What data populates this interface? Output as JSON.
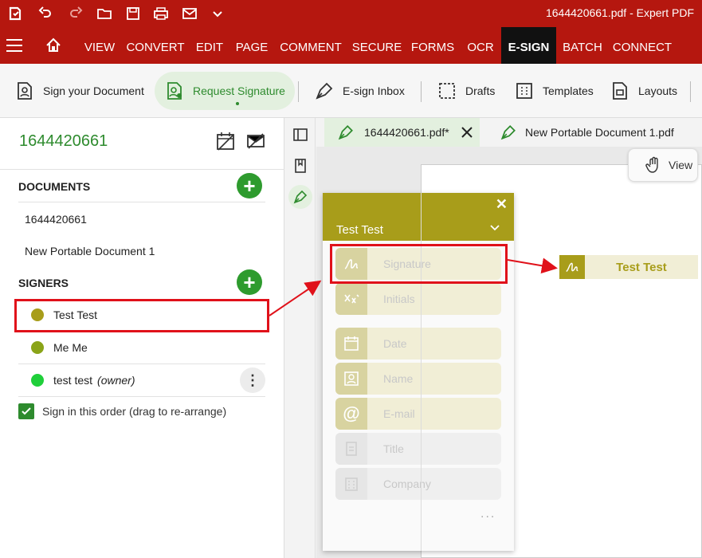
{
  "app": {
    "title": "1644420661.pdf  -  Expert PDF"
  },
  "menu": {
    "items": [
      "VIEW",
      "CONVERT",
      "EDIT",
      "PAGE",
      "COMMENT",
      "SECURE",
      "FORMS",
      "OCR",
      "E-SIGN",
      "BATCH",
      "CONNECT"
    ],
    "active": "E-SIGN"
  },
  "ribbon": {
    "sign_doc": "Sign your Document",
    "request_sig": "Request Signature",
    "inbox": "E-sign Inbox",
    "drafts": "Drafts",
    "templates": "Templates",
    "layouts": "Layouts"
  },
  "left": {
    "doc_title": "1644420661",
    "documents_label": "DOCUMENTS",
    "documents": [
      "1644420661",
      "New Portable Document 1"
    ],
    "signers_label": "SIGNERS",
    "signers": [
      {
        "name": "Test Test",
        "color": "#a89d1a"
      },
      {
        "name": "Me Me",
        "color": "#8aa418"
      },
      {
        "name": "test test",
        "role": "(owner)",
        "color": "#1fcf3a"
      }
    ],
    "sign_order": "Sign in this order (drag to re-arrange)"
  },
  "tabs": [
    "1644420661.pdf*",
    "New Portable Document 1.pdf"
  ],
  "view_label": "View",
  "popup": {
    "signer": "Test Test",
    "fields": [
      "Signature",
      "Initials",
      "Date",
      "Name",
      "E-mail",
      "Title",
      "Company"
    ],
    "more": "..."
  },
  "placed_field": {
    "label": "Test Test"
  },
  "colors": {
    "brand_red": "#b5170f",
    "accent_green": "#2e8b2e",
    "signer_olive": "#a89d1a",
    "annotation_red": "#e0111a"
  }
}
